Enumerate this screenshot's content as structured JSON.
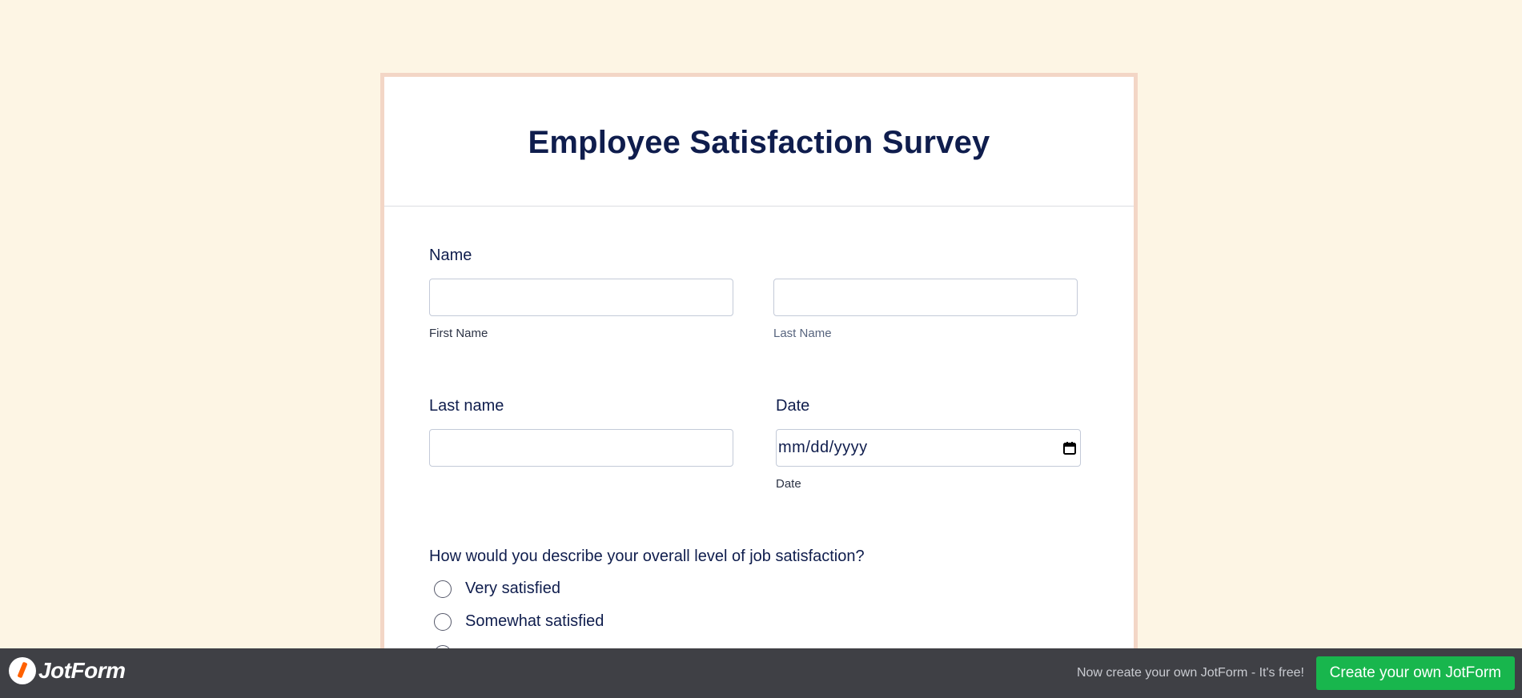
{
  "form": {
    "title": "Employee Satisfaction Survey",
    "name_field": {
      "label": "Name",
      "first_sublabel": "First Name",
      "last_sublabel": "Last Name",
      "first_value": "",
      "last_value": ""
    },
    "last_name_field": {
      "label": "Last name",
      "value": ""
    },
    "date_field": {
      "label": "Date",
      "placeholder": "mm/dd/yyyy",
      "sublabel": "Date"
    },
    "question": {
      "label": "How would you describe your overall level of job satisfaction?",
      "options": [
        "Very satisfied",
        "Somewhat satisfied"
      ]
    }
  },
  "footer": {
    "brand": "JotForm",
    "promo": "Now create your own JotForm - It's free!",
    "cta_label": "Create your own JotForm"
  },
  "colors": {
    "page_background": "#fdf5e4",
    "card_border": "#f3d6c6",
    "title_text": "#0f1d4d",
    "footer_background": "#3f4045",
    "cta_background": "#18b64d",
    "logo_accent": "#ff6100"
  },
  "icons": {
    "date_picker": "calendar-icon",
    "brand_logo": "jotform-logo-icon"
  }
}
